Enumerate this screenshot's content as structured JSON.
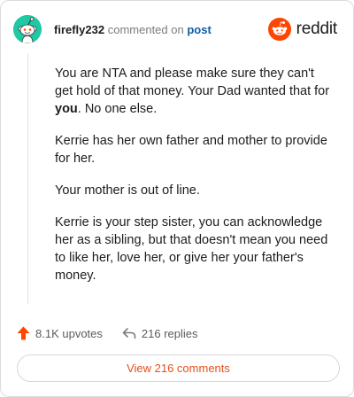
{
  "header": {
    "username": "firefly232",
    "action_text": "commented on",
    "post_link": "post",
    "logo_text": "reddit"
  },
  "comment": {
    "paragraph1_pre": "You are NTA and please make sure they can't get hold of that money. Your Dad wanted that for ",
    "paragraph1_bold": "you",
    "paragraph1_post": ". No one else.",
    "paragraph2": "Kerrie has her own father and mother to provide for her.",
    "paragraph3": "Your mother is out of line.",
    "paragraph4": "Kerrie is your step sister, you can acknowledge her as a sibling, but that doesn't mean you need to like her, love her, or give her your father's money."
  },
  "stats": {
    "upvotes": "8.1K upvotes",
    "replies": "216 replies"
  },
  "footer": {
    "view_comments": "View 216 comments"
  },
  "colors": {
    "accent": "#e2501c",
    "avatar_bg": "#1ec9a4",
    "link": "#0b5fa8"
  },
  "icons": {
    "avatar": "reddit-snoo-avatar",
    "logo": "reddit-snoo-logo",
    "upvote": "upvote-arrow-icon",
    "reply": "reply-arrow-icon"
  }
}
